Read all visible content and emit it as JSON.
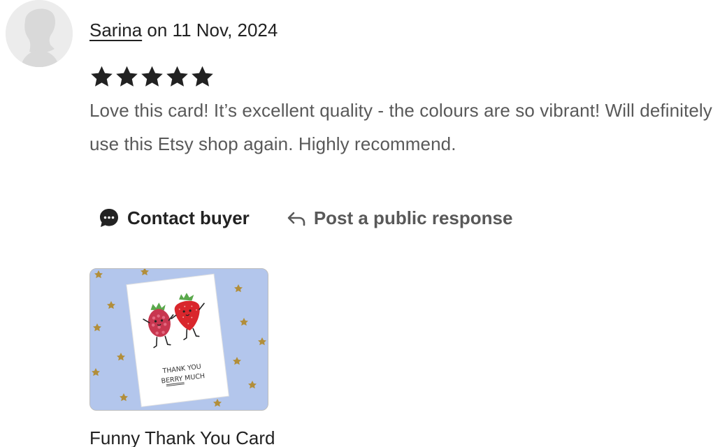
{
  "review": {
    "reviewer_name": "Sarina",
    "date_prefix": "on",
    "date": "11 Nov, 2024",
    "rating": 5,
    "rating_max": 5,
    "text": "Love this card! It’s excellent quality - the colours are so vibrant! Will definitely use this Etsy shop again. Highly recommend."
  },
  "actions": {
    "contact_label": "Contact buyer",
    "respond_label": "Post a public response"
  },
  "listing": {
    "image_text_line1": "THANK YOU",
    "image_text_line2": "BERRY MUCH",
    "title": "Funny Thank You Card"
  },
  "colors": {
    "text": "#222222",
    "muted_text": "#595959",
    "star": "#222222",
    "thumb_background": "#b3c6ec"
  }
}
